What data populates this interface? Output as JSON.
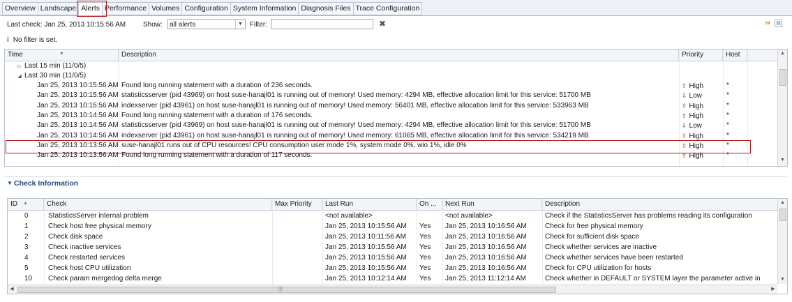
{
  "tabs": [
    {
      "label": "Overview",
      "active": false
    },
    {
      "label": "Landscape",
      "active": false
    },
    {
      "label": "Alerts",
      "active": true
    },
    {
      "label": "Performance",
      "active": false
    },
    {
      "label": "Volumes",
      "active": false
    },
    {
      "label": "Configuration",
      "active": false
    },
    {
      "label": "System Information",
      "active": false
    },
    {
      "label": "Diagnosis Files",
      "active": false
    },
    {
      "label": "Trace Configuration",
      "active": false
    }
  ],
  "toolbar": {
    "last_check": "Last check: Jan 25, 2013 10:15:56 AM",
    "show_label": "Show:",
    "show_value": "all alerts",
    "filter_label": "Filter:",
    "filter_value": "",
    "clear_icon": "clear-filter-icon",
    "right_icons": [
      "export-icon",
      "settings-icon"
    ]
  },
  "filter_message": "No filter is set.",
  "alerts_table": {
    "columns": [
      "Time",
      "Description",
      "Priority",
      "Host"
    ],
    "groups": [
      {
        "label": "Last 15 min (11/0/5)",
        "expanded": false
      },
      {
        "label": "Last 30 min (11/0/5)",
        "expanded": true
      }
    ],
    "rows": [
      {
        "time": "Jan 25, 2013 10:15:56 AM",
        "description": "Found long running statement with a duration of 236 seconds.",
        "priority": "High",
        "dir": "up",
        "host": "*"
      },
      {
        "time": "Jan 25, 2013 10:15:56 AM",
        "description": "statisticsserver (pid 43969) on host suse-hanajl01 is running out of memory! Used memory: 4294 MB, effective allocation limit for this service: 51700 MB",
        "priority": "Low",
        "dir": "down",
        "host": "*"
      },
      {
        "time": "Jan 25, 2013 10:15:56 AM",
        "description": "indexserver (pid 43961) on host suse-hanajl01 is running out of memory! Used memory: 56401 MB, effective allocation limit for this service: 533963 MB",
        "priority": "High",
        "dir": "up",
        "host": "*"
      },
      {
        "time": "Jan 25, 2013 10:14:56 AM",
        "description": "Found long running statement with a duration of 176 seconds.",
        "priority": "High",
        "dir": "up",
        "host": "*"
      },
      {
        "time": "Jan 25, 2013 10:14:56 AM",
        "description": "statisticsserver (pid 43969) on host suse-hanajl01 is running out of memory! Used memory: 4294 MB, effective allocation limit for this service: 51700 MB",
        "priority": "Low",
        "dir": "down",
        "host": "*"
      },
      {
        "time": "Jan 25, 2013 10:14:56 AM",
        "description": "indexserver (pid 43961) on host suse-hanajl01 is running out of memory! Used memory: 61065 MB, effective allocation limit for this service: 534219 MB",
        "priority": "High",
        "dir": "up",
        "host": "*"
      },
      {
        "time": "Jan 25, 2013 10:13:56 AM",
        "description": "suse-hanajl01 runs out of CPU resources! CPU consumption user mode 1%, system mode 0%, wio 1%, idle 0%",
        "priority": "High",
        "dir": "up",
        "host": "*"
      },
      {
        "time": "Jan 25, 2013 10:13:56 AM",
        "description": "Found long running statement with a duration of 117 seconds.",
        "priority": "High",
        "dir": "up",
        "host": "*"
      }
    ]
  },
  "check_section": {
    "title": "Check Information"
  },
  "check_table": {
    "columns": [
      "ID",
      "Check",
      "Max Priority",
      "Last Run",
      "On ...",
      "Next Run",
      "Description"
    ],
    "rows": [
      {
        "id": "0",
        "check": "StatisticsServer internal problem",
        "max_priority": "",
        "last_run": "<not available>",
        "on": "",
        "next_run": "<not available>",
        "description": "Check if the StatisticsServer has problems reading its configuration"
      },
      {
        "id": "1",
        "check": "Check host free physical memory",
        "max_priority": "",
        "last_run": "Jan 25, 2013 10:15:56 AM",
        "on": "Yes",
        "next_run": "Jan 25, 2013 10:16:56 AM",
        "description": "Check for free physical memory"
      },
      {
        "id": "2",
        "check": "Check disk space",
        "max_priority": "",
        "last_run": "Jan 25, 2013 10:11:56 AM",
        "on": "Yes",
        "next_run": "Jan 25, 2013 10:16:56 AM",
        "description": "Check for sufficient disk space"
      },
      {
        "id": "3",
        "check": "Check inactive services",
        "max_priority": "",
        "last_run": "Jan 25, 2013 10:15:56 AM",
        "on": "Yes",
        "next_run": "Jan 25, 2013 10:16:56 AM",
        "description": "Check whether services are inactive"
      },
      {
        "id": "4",
        "check": "Check restarted services",
        "max_priority": "",
        "last_run": "Jan 25, 2013 10:15:56 AM",
        "on": "Yes",
        "next_run": "Jan 25, 2013 10:16:56 AM",
        "description": "Check whether services have been restarted"
      },
      {
        "id": "5",
        "check": "Check host CPU utilization",
        "max_priority": "",
        "last_run": "Jan 25, 2013 10:15:56 AM",
        "on": "Yes",
        "next_run": "Jan 25, 2013 10:16:56 AM",
        "description": "Check for CPU utilization for hosts"
      },
      {
        "id": "10",
        "check": "Check param mergedog delta merge",
        "max_priority": "",
        "last_run": "Jan 25, 2013 10:12:14 AM",
        "on": "Yes",
        "next_run": "Jan 25, 2013 11:12:14 AM",
        "description": "Check whether in DEFAULT or SYSTEM layer the parameter active in"
      }
    ]
  },
  "colors": {
    "highlight": "#b5121b",
    "priority_high": "#c0392b",
    "section_title": "#254a7b"
  }
}
